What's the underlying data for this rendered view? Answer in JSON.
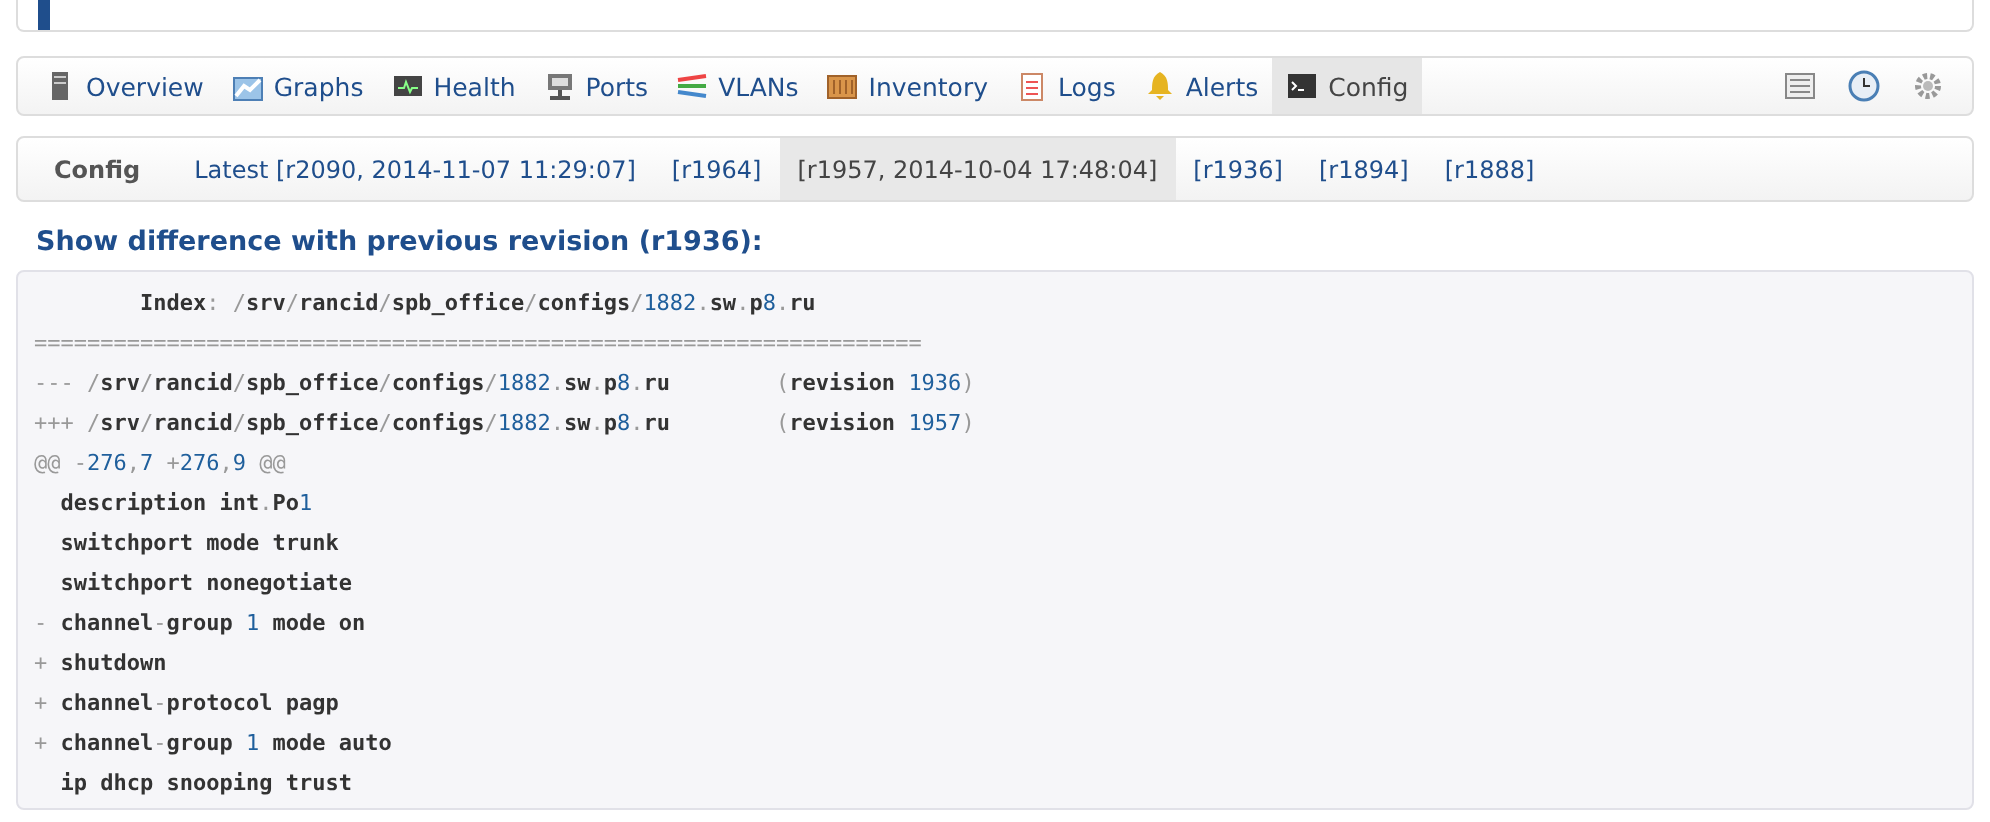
{
  "tabs": [
    {
      "label": "Overview",
      "selected": false
    },
    {
      "label": "Graphs",
      "selected": false
    },
    {
      "label": "Health",
      "selected": false
    },
    {
      "label": "Ports",
      "selected": false
    },
    {
      "label": "VLANs",
      "selected": false
    },
    {
      "label": "Inventory",
      "selected": false
    },
    {
      "label": "Logs",
      "selected": false
    },
    {
      "label": "Alerts",
      "selected": false
    },
    {
      "label": "Config",
      "selected": true
    }
  ],
  "revisions": {
    "label": "Config",
    "items": [
      {
        "text": "Latest [r2090, 2014-11-07 11:29:07]",
        "selected": false
      },
      {
        "text": "[r1964]",
        "selected": false
      },
      {
        "text": "[r1957, 2014-10-04 17:48:04]",
        "selected": true
      },
      {
        "text": "[r1936]",
        "selected": false
      },
      {
        "text": "[r1894]",
        "selected": false
      },
      {
        "text": "[r1888]",
        "selected": false
      }
    ]
  },
  "heading": "Show difference with previous revision (r1936):",
  "diff_lines": [
    "        Index: /srv/rancid/spb_office/configs/1882.sw.p8.ru",
    "===================================================================",
    "--- /srv/rancid/spb_office/configs/1882.sw.p8.ru        (revision 1936)",
    "+++ /srv/rancid/spb_office/configs/1882.sw.p8.ru        (revision 1957)",
    "@@ -276,7 +276,9 @@",
    "  description int.Po1",
    "  switchport mode trunk",
    "  switchport nonegotiate",
    "- channel-group 1 mode on",
    "+ shutdown",
    "+ channel-protocol pagp",
    "+ channel-group 1 mode auto",
    "  ip dhcp snooping trust"
  ]
}
